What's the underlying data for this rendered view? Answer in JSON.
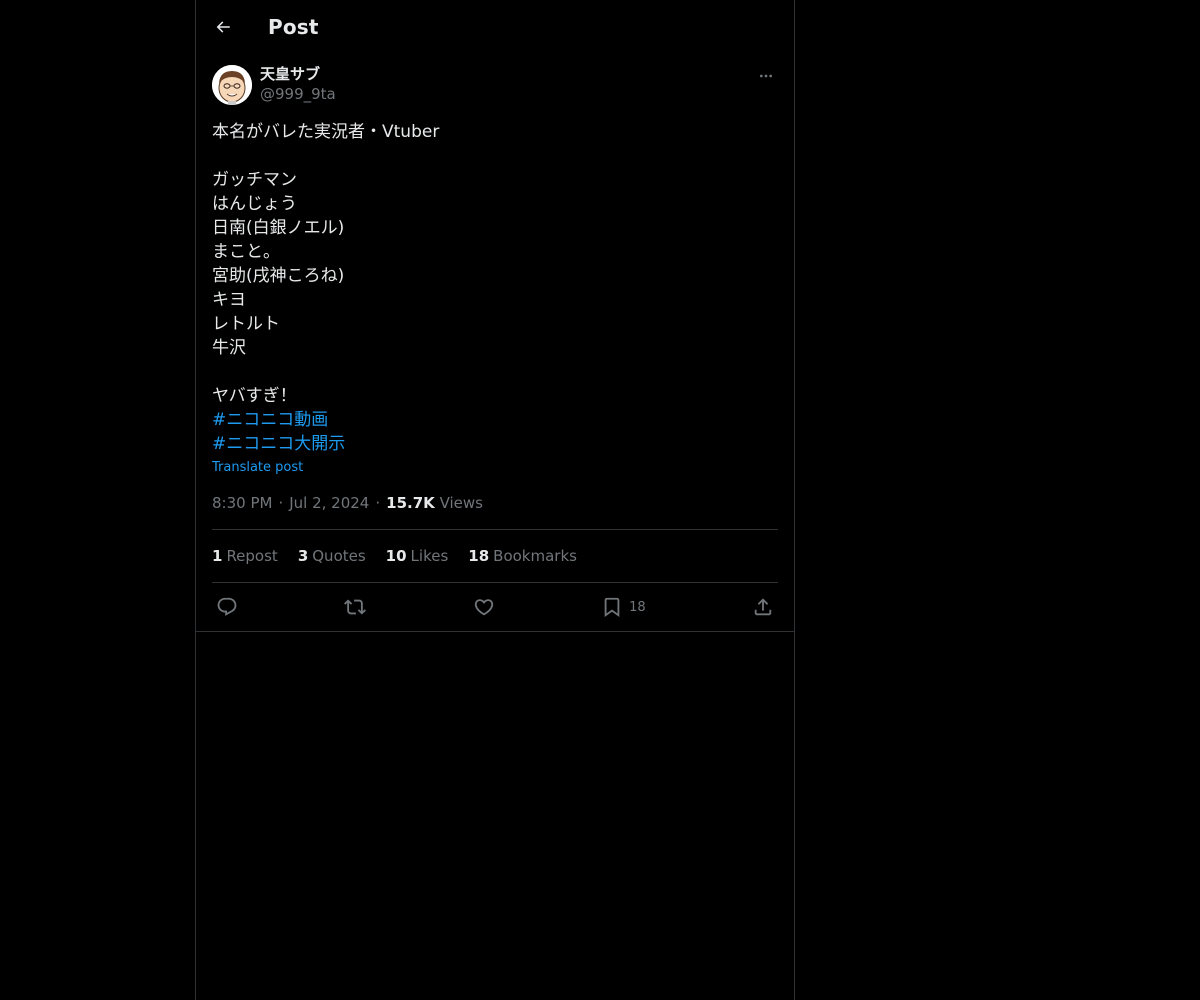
{
  "header": {
    "title": "Post"
  },
  "author": {
    "display_name": "天皇サブ",
    "handle": "@999_9ta"
  },
  "post": {
    "lines": [
      "本名がバレた実況者・Vtuber",
      "",
      "ガッチマン",
      "はんじょう",
      "日南(白銀ノエル)",
      "まこと。",
      "宮助(戌神ころね)",
      "キヨ",
      "レトルト",
      "牛沢",
      "",
      "ヤバすぎ！"
    ],
    "hashtags": [
      "#ニコニコ動画",
      "#ニコニコ大開示"
    ],
    "translate_label": "Translate post"
  },
  "meta": {
    "time": "8:30 PM",
    "date": "Jul 2, 2024",
    "separator": "·",
    "views_count": "15.7K",
    "views_label": "Views"
  },
  "stats": {
    "reposts_count": "1",
    "reposts_label": "Repost",
    "quotes_count": "3",
    "quotes_label": "Quotes",
    "likes_count": "10",
    "likes_label": "Likes",
    "bookmarks_count": "18",
    "bookmarks_label": "Bookmarks"
  },
  "actions": {
    "bookmark_count": "18",
    "icons": [
      "reply-icon",
      "repost-icon",
      "like-icon",
      "bookmark-icon",
      "share-icon"
    ]
  },
  "colors": {
    "background": "#000000",
    "text": "#e7e9ea",
    "secondary": "#71767b",
    "accent": "#1d9bf0",
    "border": "#2f3336"
  }
}
